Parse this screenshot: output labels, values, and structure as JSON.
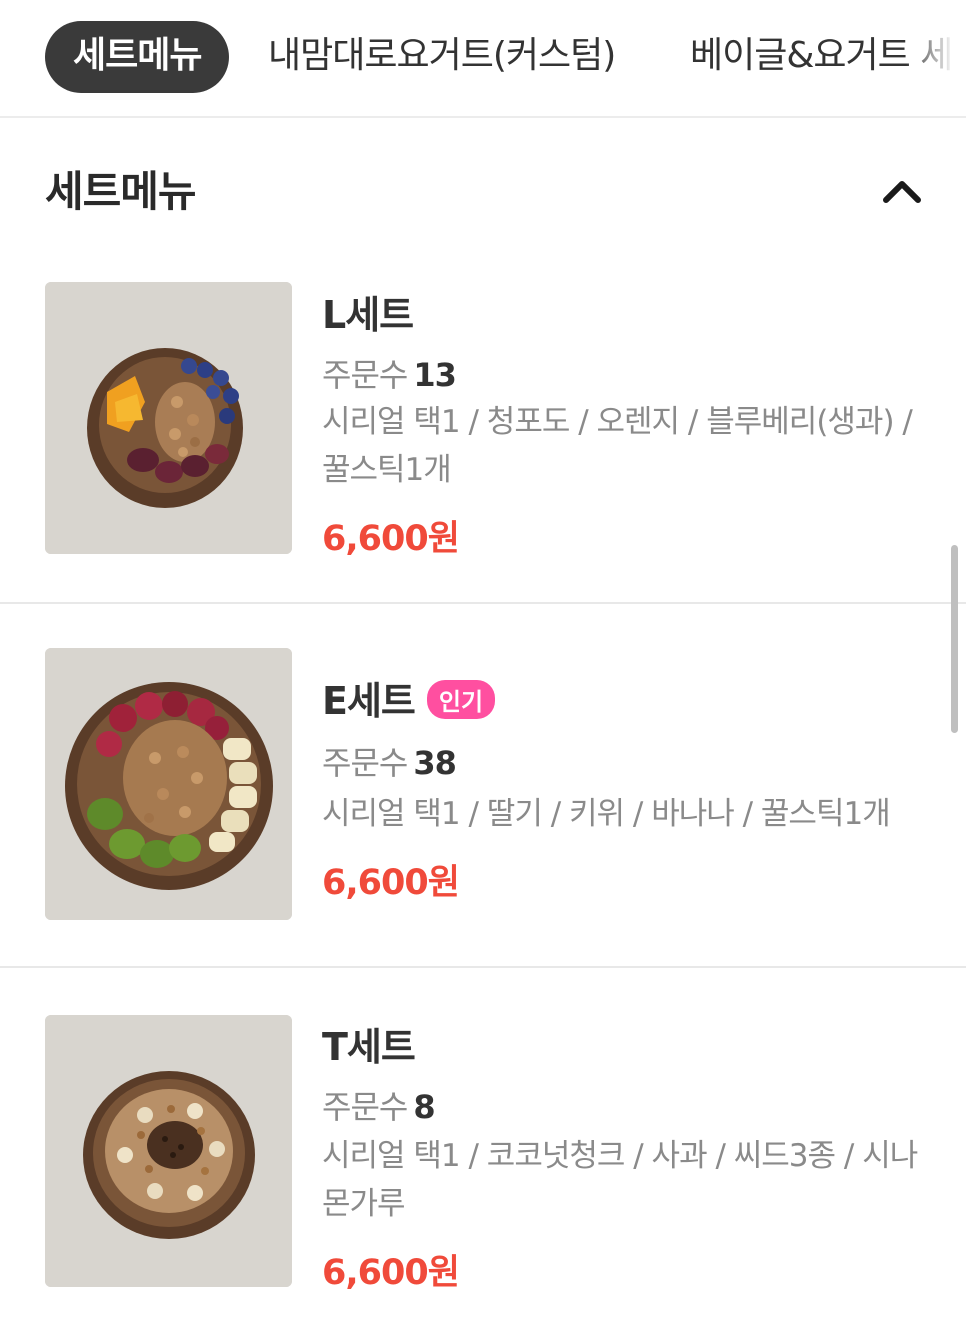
{
  "tabs": [
    {
      "label": "세트메뉴",
      "active": true
    },
    {
      "label": "내맘대로요거트(커스텀)",
      "active": false
    },
    {
      "label": "베이글&요거트 세",
      "active": false
    }
  ],
  "section": {
    "title": "세트메뉴",
    "collapse_icon": "chevron-up-icon"
  },
  "orders_label": "주문수",
  "items": [
    {
      "name": "L세트",
      "badge": "",
      "orders": "13",
      "desc": "시리얼 택1 / 청포도 / 오렌지 / 블루베리(생과) / 꿀스틱1개",
      "price": "6,600원"
    },
    {
      "name": "E세트",
      "badge": "인기",
      "orders": "38",
      "desc": "시리얼 택1 / 딸기 / 키위 / 바나나 / 꿀스틱1개",
      "price": "6,600원"
    },
    {
      "name": "T세트",
      "badge": "",
      "orders": "8",
      "desc": "시리얼 택1 / 코코넛청크 / 사과 / 씨드3종 / 시나몬가루",
      "price": "6,600원"
    }
  ],
  "colors": {
    "price": "#f04a3a",
    "badge": "#ff4fa0",
    "active_tab": "#3a3a3a"
  }
}
